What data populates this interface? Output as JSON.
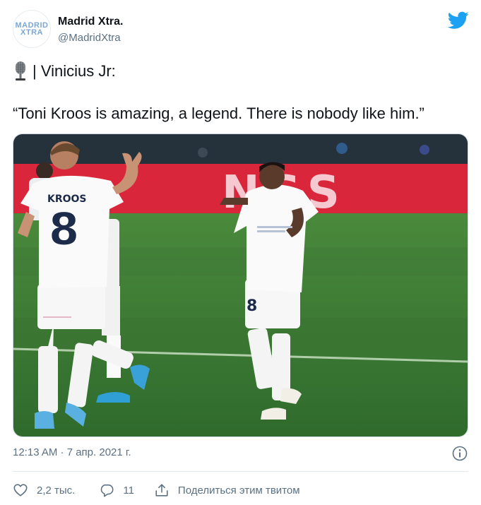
{
  "account": {
    "display_name": "Madrid Xtra.",
    "handle": "@MadridXtra",
    "avatar_line1": "MADRID",
    "avatar_line2": "XTRA"
  },
  "tweet": {
    "line1": "| Vinicius Jr:",
    "quote": "“Toni Kroos is amazing, a legend. There is nobody like him.”",
    "timestamp": "12:13 AM · 7 апр. 2021 г."
  },
  "photo": {
    "ad_board_text": "NSS",
    "player_left_name": "KROOS",
    "player_left_number": "8",
    "player_right_number": "8"
  },
  "actions": {
    "likes": "2,2 тыс.",
    "replies": "11",
    "share_label": "Поделиться этим твитом"
  },
  "colors": {
    "twitter_blue": "#1da1f2",
    "text_secondary": "#5b7083",
    "pitch_green": "#3f7a35",
    "ad_red": "#d9263a"
  },
  "icons": [
    "twitter-bird-icon",
    "microphone-icon",
    "info-icon",
    "heart-icon",
    "reply-icon",
    "share-icon"
  ]
}
